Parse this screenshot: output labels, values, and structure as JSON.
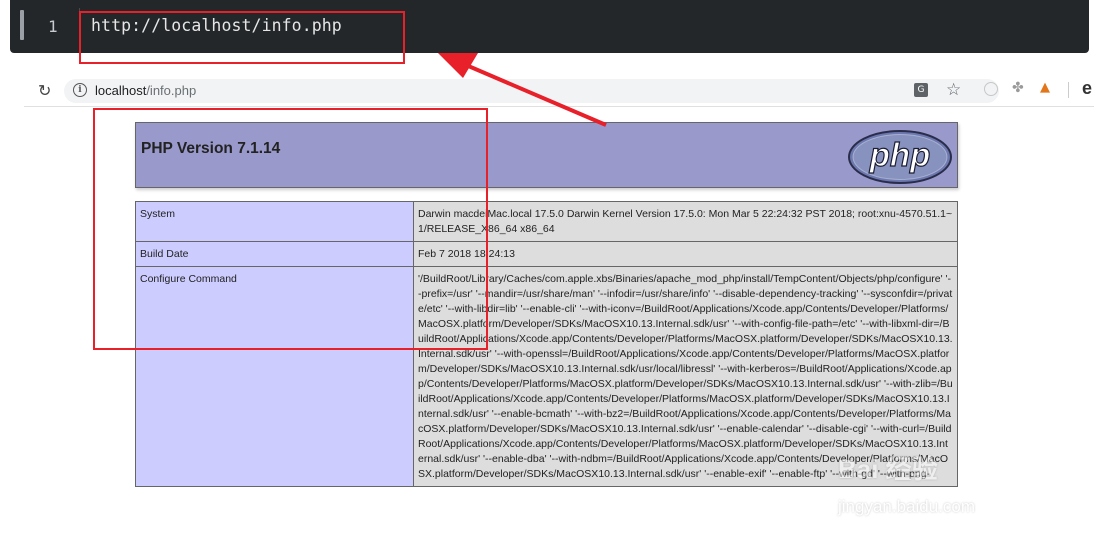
{
  "editor": {
    "line_number": "1",
    "code": "http://localhost/info.php"
  },
  "browser": {
    "url_host": "localhost",
    "url_path": "/info.php",
    "icons": [
      "reload-icon",
      "info-icon",
      "translate-icon",
      "star-icon",
      "extension-icon",
      "profile-icon"
    ]
  },
  "php": {
    "title": "PHP Version 7.1.14",
    "logo_text": "php",
    "rows": [
      {
        "label": "System",
        "value": "Darwin macdeiMac.local 17.5.0 Darwin Kernel Version 17.5.0: Mon Mar 5 22:24:32 PST 2018; root:xnu-4570.51.1~1/RELEASE_X86_64 x86_64"
      },
      {
        "label": "Build Date",
        "value": "Feb 7 2018 18:24:13"
      },
      {
        "label": "Configure Command",
        "value": "'/BuildRoot/Library/Caches/com.apple.xbs/Binaries/apache_mod_php/install/TempContent/Objects/php/configure' '--prefix=/usr' '--mandir=/usr/share/man' '--infodir=/usr/share/info' '--disable-dependency-tracking' '--sysconfdir=/private/etc' '--with-libdir=lib' '--enable-cli' '--with-iconv=/BuildRoot/Applications/Xcode.app/Contents/Developer/Platforms/MacOSX.platform/Developer/SDKs/MacOSX10.13.Internal.sdk/usr' '--with-config-file-path=/etc' '--with-libxml-dir=/BuildRoot/Applications/Xcode.app/Contents/Developer/Platforms/MacOSX.platform/Developer/SDKs/MacOSX10.13.Internal.sdk/usr' '--with-openssl=/BuildRoot/Applications/Xcode.app/Contents/Developer/Platforms/MacOSX.platform/Developer/SDKs/MacOSX10.13.Internal.sdk/usr/local/libressl' '--with-kerberos=/BuildRoot/Applications/Xcode.app/Contents/Developer/Platforms/MacOSX.platform/Developer/SDKs/MacOSX10.13.Internal.sdk/usr' '--with-zlib=/BuildRoot/Applications/Xcode.app/Contents/Developer/Platforms/MacOSX.platform/Developer/SDKs/MacOSX10.13.Internal.sdk/usr' '--enable-bcmath' '--with-bz2=/BuildRoot/Applications/Xcode.app/Contents/Developer/Platforms/MacOSX.platform/Developer/SDKs/MacOSX10.13.Internal.sdk/usr' '--enable-calendar' '--disable-cgi' '--with-curl=/BuildRoot/Applications/Xcode.app/Contents/Developer/Platforms/MacOSX.platform/Developer/SDKs/MacOSX10.13.Internal.sdk/usr' '--enable-dba' '--with-ndbm=/BuildRoot/Applications/Xcode.app/Contents/Developer/Platforms/MacOSX.platform/Developer/SDKs/MacOSX10.13.Internal.sdk/usr' '--enable-exif' '--enable-ftp' '--with-gd' '--with-png-"
      }
    ]
  },
  "annotation": {
    "color": "#e8202a"
  },
  "watermark": {
    "line1": "Bai 经验",
    "line2": "jingyan.baidu.com"
  }
}
